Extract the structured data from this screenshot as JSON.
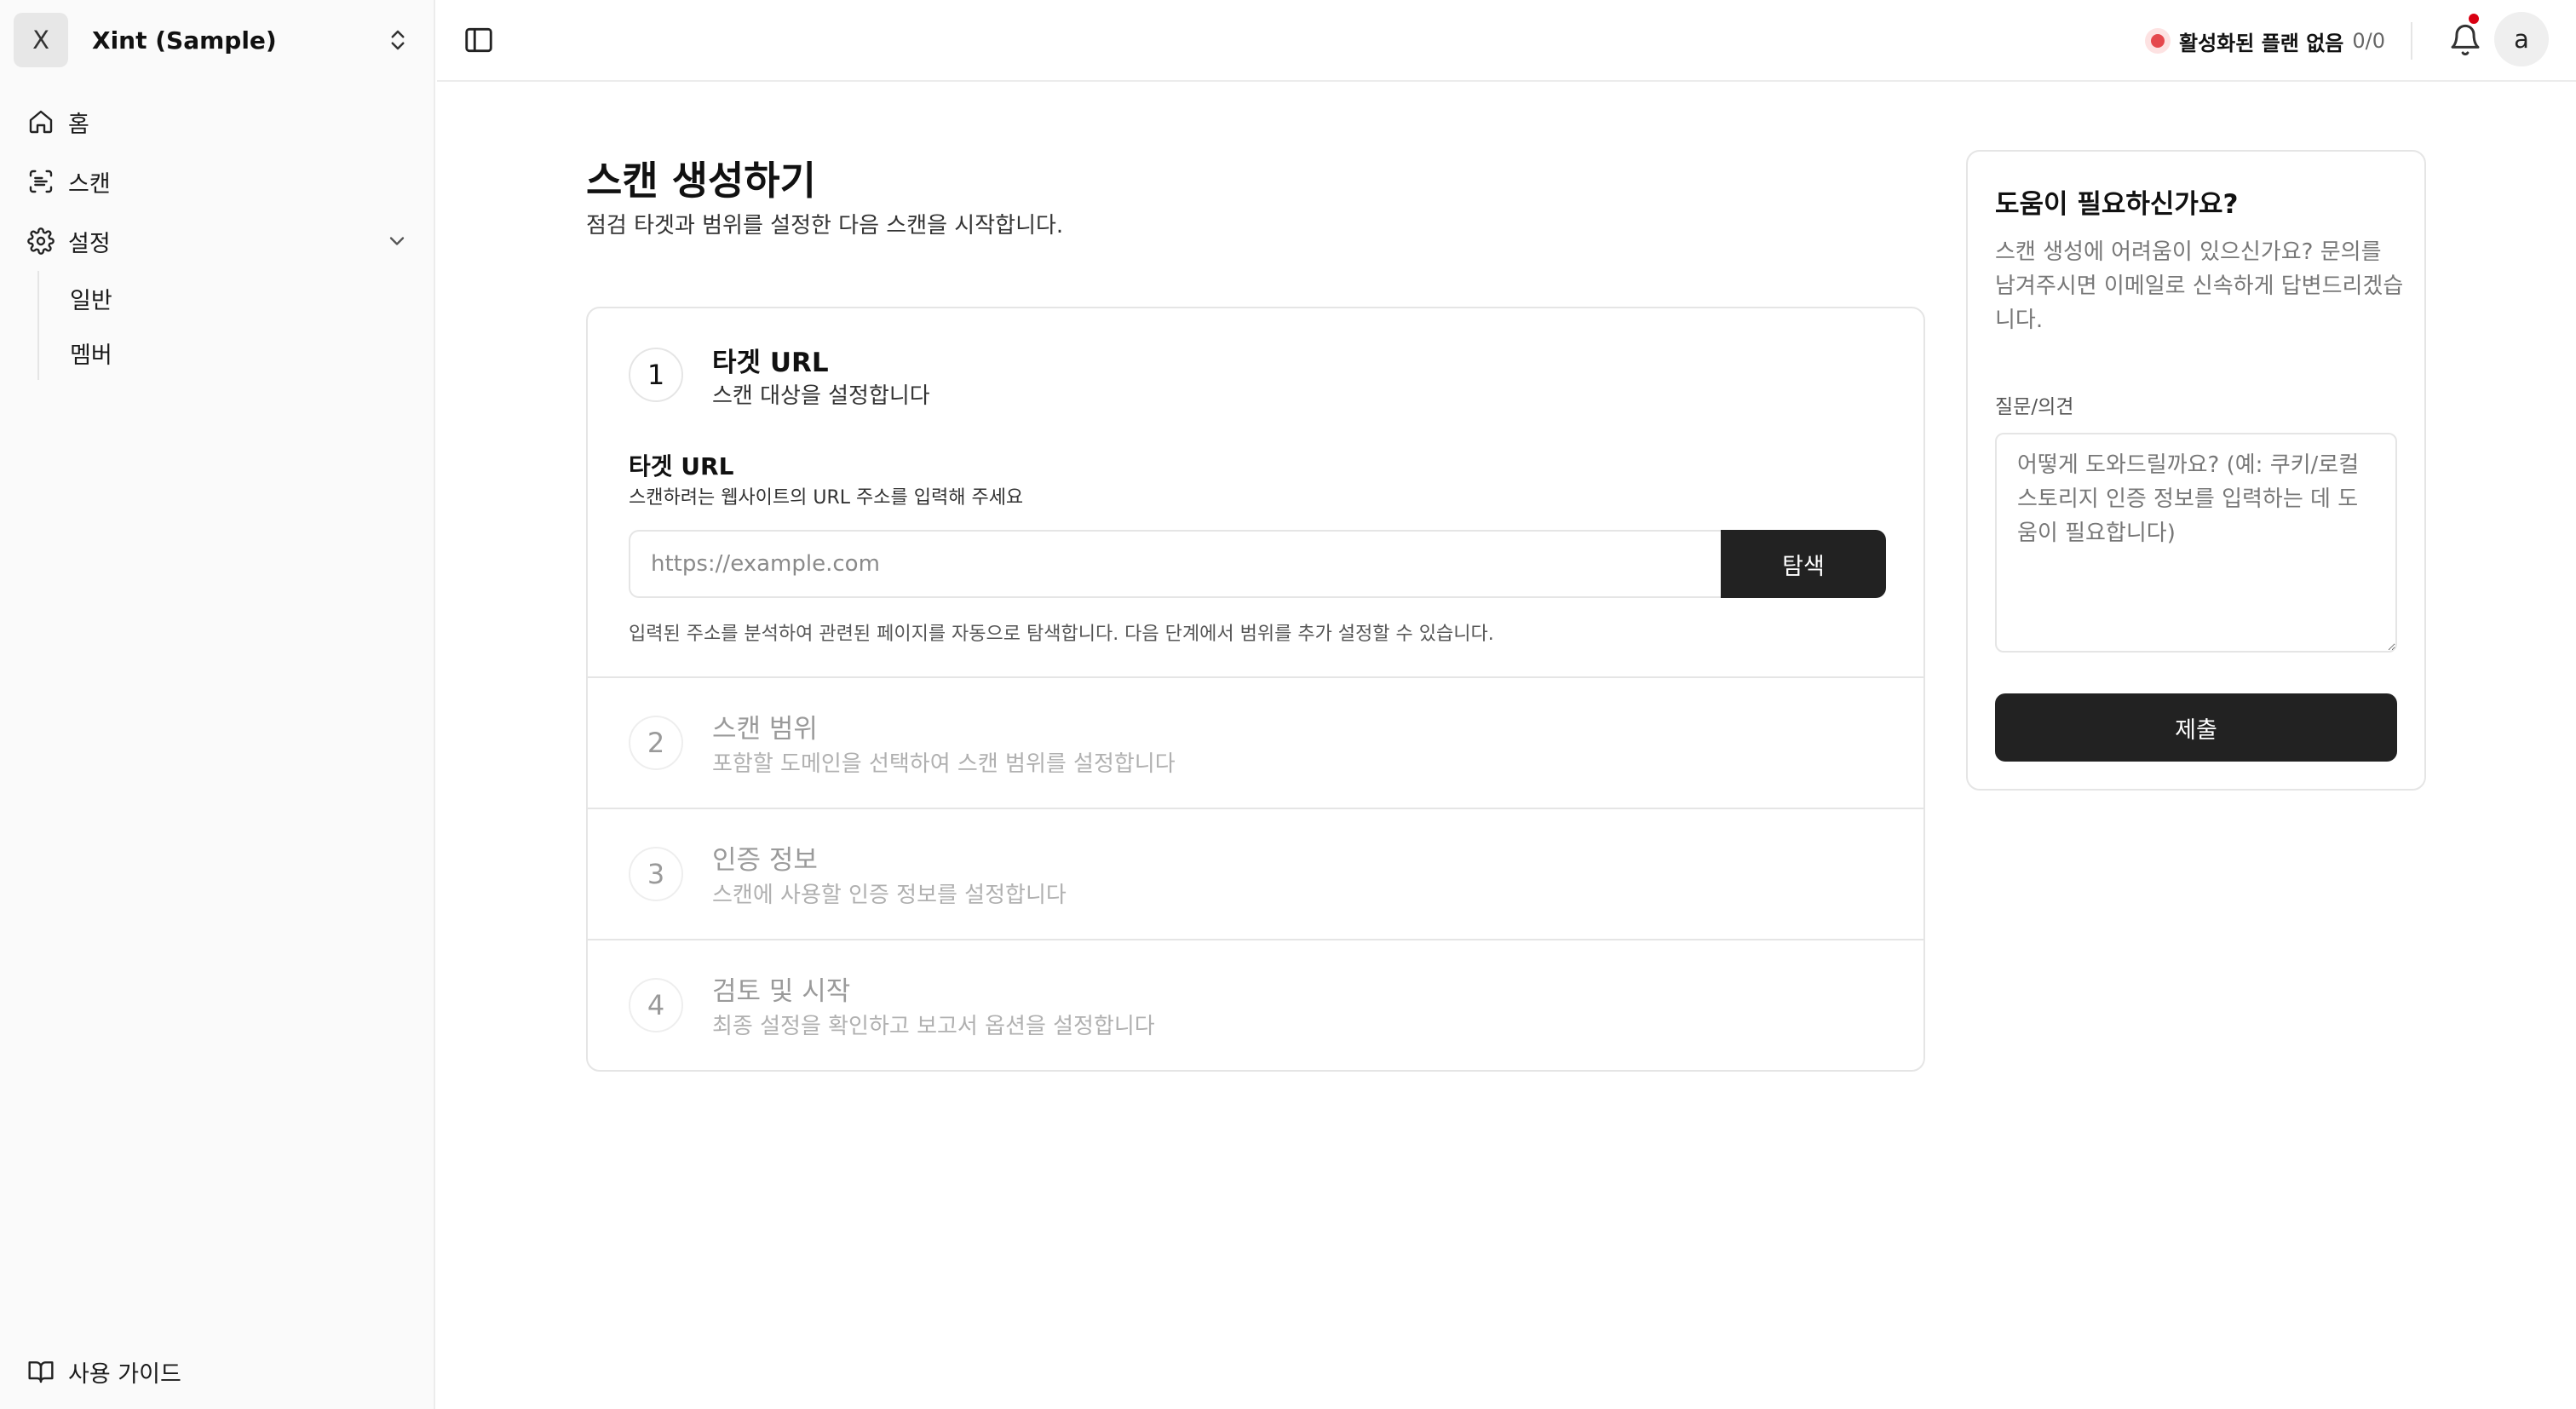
{
  "workspace": {
    "initial": "X",
    "name": "Xint (Sample)"
  },
  "sidebar": {
    "items": [
      {
        "label": "홈",
        "icon": "home-icon"
      },
      {
        "label": "스캔",
        "icon": "scan-icon"
      },
      {
        "label": "설정",
        "icon": "gear-icon"
      }
    ],
    "settings_sub": [
      {
        "label": "일반"
      },
      {
        "label": "멤버"
      }
    ],
    "guide_label": "사용 가이드"
  },
  "header": {
    "plan_label": "활성화된 플랜 없음",
    "plan_count": "0/0",
    "user_initial": "a",
    "status_color": "#e5484d",
    "notification_dot_color": "#d90012"
  },
  "main": {
    "title": "스캔 생성하기",
    "subtitle": "점검 타겟과 범위를 설정한 다음 스캔을 시작합니다."
  },
  "steps": [
    {
      "num": "1",
      "title": "타겟 URL",
      "desc": "스캔 대상을 설정합니다"
    },
    {
      "num": "2",
      "title": "스캔 범위",
      "desc": "포함할 도메인을 선택하여 스캔 범위를 설정합니다"
    },
    {
      "num": "3",
      "title": "인증 정보",
      "desc": "스캔에 사용할 인증 정보를 설정합니다"
    },
    {
      "num": "4",
      "title": "검토 및 시작",
      "desc": "최종 설정을 확인하고 보고서 옵션을 설정합니다"
    }
  ],
  "target_form": {
    "label": "타겟 URL",
    "help": "스캔하려는 웹사이트의 URL 주소를 입력해 주세요",
    "placeholder": "https://example.com",
    "button_label": "탐색",
    "note": "입력된 주소를 분석하여 관련된 페이지를 자동으로 탐색합니다. 다음 단계에서 범위를 추가 설정할 수 있습니다."
  },
  "help_card": {
    "title": "도움이 필요하신가요?",
    "text": "스캔 생성에 어려움이 있으신가요? 문의를 남겨주시면 이메일로 신속하게 답변드리겠습니다.",
    "field_label": "질문/의견",
    "placeholder": "어떻게 도와드릴까요? (예: 쿠키/로컬 스토리지 인증 정보를 입력하는 데 도움이 필요합니다)",
    "submit_label": "제출"
  }
}
